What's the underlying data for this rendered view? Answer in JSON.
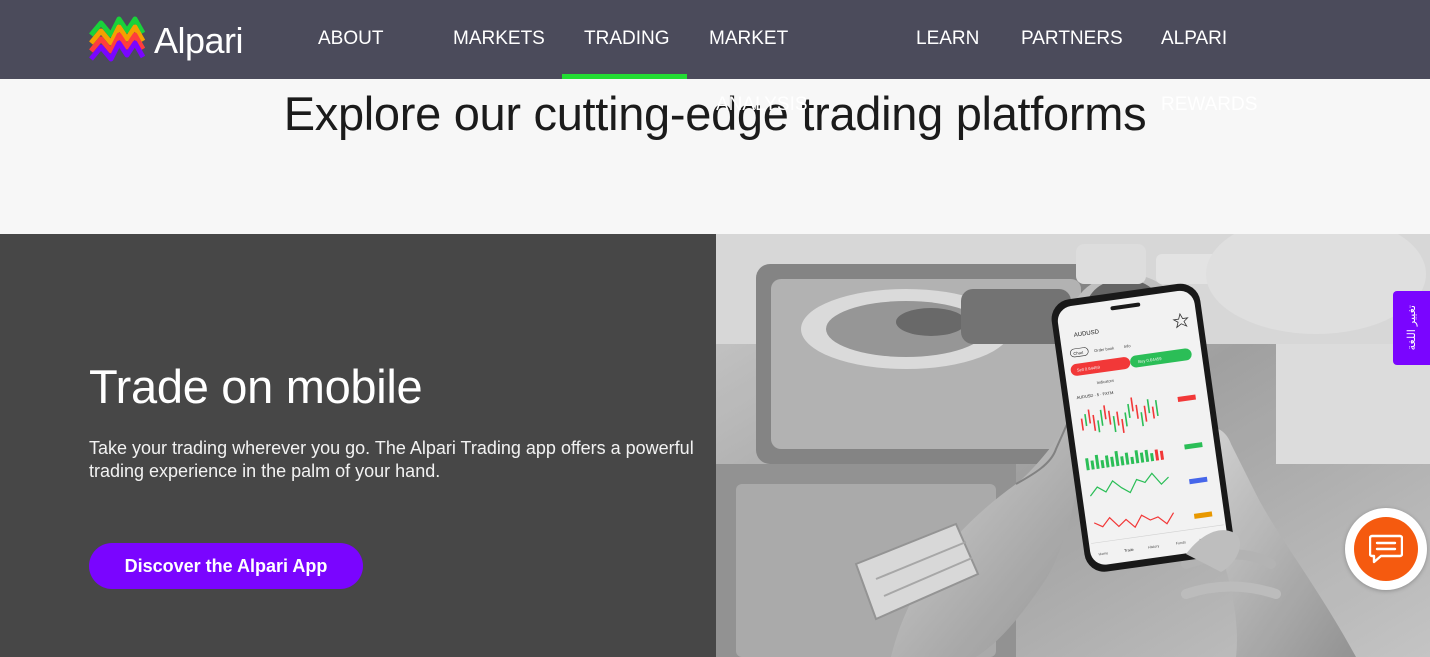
{
  "brand": {
    "name": "Alpari"
  },
  "nav": {
    "items": [
      {
        "label": "ABOUT",
        "sub": ""
      },
      {
        "label": "MARKETS",
        "sub": ""
      },
      {
        "label": "TRADING",
        "sub": ""
      },
      {
        "label": "MARKET",
        "sub": "ANALYSIS"
      },
      {
        "label": "LEARN",
        "sub": ""
      },
      {
        "label": "PARTNERS",
        "sub": ""
      },
      {
        "label": "ALPARI",
        "sub": "REWARDS"
      }
    ],
    "active": "TRADING"
  },
  "hero": {
    "title": "Explore our cutting-edge trading platforms"
  },
  "mobile_section": {
    "title": "Trade on mobile",
    "description": "Take your trading wherever you go. The Alpari Trading app offers a powerful trading experience in the palm of your hand.",
    "cta_label": "Discover the Alpari App"
  },
  "phone_screen": {
    "symbol": "AUDUSD",
    "tabs": [
      "Chart",
      "Order book",
      "Info"
    ],
    "sell_label": "Sell 0.64459",
    "buy_label": "Buy 0.64459",
    "chart_label": "AUDUSD · 5 · FXTM",
    "indicators_label": "Indicators",
    "nav_items": [
      "Home",
      "Trade",
      "History",
      "Funds",
      "More"
    ]
  },
  "widgets": {
    "language_tab": "تغيير اللغة",
    "chat_icon": "chat-bubble-icon"
  },
  "colors": {
    "header_bg": "#4b4b5b",
    "active_indicator": "#22dd33",
    "accent_purple": "#7a05ff",
    "chat_orange": "#f55a0f",
    "panel_dark": "#474747"
  }
}
